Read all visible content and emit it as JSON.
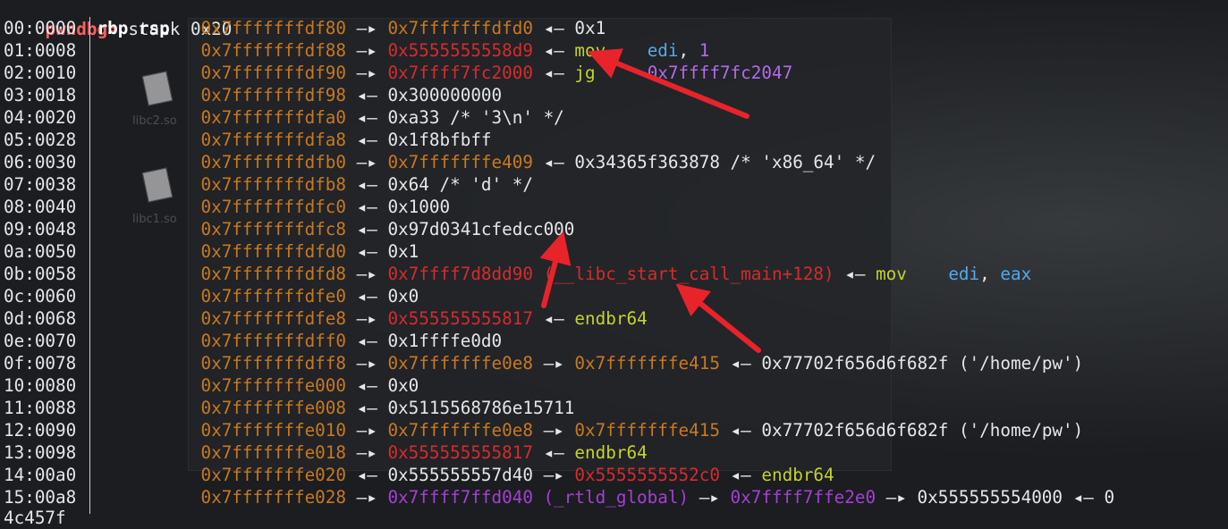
{
  "prompt": {
    "name": "pwndbg",
    "symbol": ">",
    "command": "stack 0x20"
  },
  "colors": {
    "stack_addr": "#c8791f",
    "code_addr": "#d72b2b",
    "heap_addr": "#a63fd3",
    "mnemonic": "#c5d22b",
    "register_operand": "#53a9e9",
    "prompt": "#ff5f5f",
    "annotation_arrow": "#e8232a"
  },
  "background": {
    "icons": [
      {
        "label": "libc2.so"
      },
      {
        "label": "libc1.so"
      }
    ]
  },
  "rows": [
    {
      "offset": "00:0000",
      "regs": "rbp rsp",
      "segs": [
        {
          "t": "0x7fffffffdf80",
          "c": "stack"
        },
        {
          "t": " —▸ ",
          "c": "arrowc"
        },
        {
          "t": "0x7fffffffdfd0",
          "c": "stack"
        },
        {
          "t": " ◂— ",
          "c": "arrowc"
        },
        {
          "t": "0x1",
          "c": "plain"
        }
      ]
    },
    {
      "offset": "01:0008",
      "regs": "",
      "segs": [
        {
          "t": "0x7fffffffdf88",
          "c": "stack"
        },
        {
          "t": " —▸ ",
          "c": "arrowc"
        },
        {
          "t": "0x5555555558d9",
          "c": "code"
        },
        {
          "t": " ◂— ",
          "c": "arrowc"
        },
        {
          "t": "mov    ",
          "c": "mnem"
        },
        {
          "t": "edi",
          "c": "op"
        },
        {
          "t": ", ",
          "c": "plain"
        },
        {
          "t": "1",
          "c": "opp"
        }
      ]
    },
    {
      "offset": "02:0010",
      "regs": "",
      "segs": [
        {
          "t": "0x7fffffffdf90",
          "c": "stack"
        },
        {
          "t": " —▸ ",
          "c": "arrowc"
        },
        {
          "t": "0x7ffff7fc2000",
          "c": "code"
        },
        {
          "t": " ◂— ",
          "c": "arrowc"
        },
        {
          "t": "jg     ",
          "c": "mnem"
        },
        {
          "t": "0x7ffff7fc2047",
          "c": "opp"
        }
      ]
    },
    {
      "offset": "03:0018",
      "regs": "",
      "segs": [
        {
          "t": "0x7fffffffdf98",
          "c": "stack"
        },
        {
          "t": " ◂— ",
          "c": "arrowc"
        },
        {
          "t": "0x300000000",
          "c": "plain"
        }
      ]
    },
    {
      "offset": "04:0020",
      "regs": "",
      "segs": [
        {
          "t": "0x7fffffffdfa0",
          "c": "stack"
        },
        {
          "t": " ◂— ",
          "c": "arrowc"
        },
        {
          "t": "0xa33 /* '3\\n' */",
          "c": "plain"
        }
      ]
    },
    {
      "offset": "05:0028",
      "regs": "",
      "segs": [
        {
          "t": "0x7fffffffdfa8",
          "c": "stack"
        },
        {
          "t": " ◂— ",
          "c": "arrowc"
        },
        {
          "t": "0x1f8bfbff",
          "c": "plain"
        }
      ]
    },
    {
      "offset": "06:0030",
      "regs": "",
      "segs": [
        {
          "t": "0x7fffffffdfb0",
          "c": "stack"
        },
        {
          "t": " —▸ ",
          "c": "arrowc"
        },
        {
          "t": "0x7fffffffe409",
          "c": "stack"
        },
        {
          "t": " ◂— ",
          "c": "arrowc"
        },
        {
          "t": "0x34365f363878 /* 'x86_64' */",
          "c": "plain"
        }
      ]
    },
    {
      "offset": "07:0038",
      "regs": "",
      "segs": [
        {
          "t": "0x7fffffffdfb8",
          "c": "stack"
        },
        {
          "t": " ◂— ",
          "c": "arrowc"
        },
        {
          "t": "0x64 /* 'd' */",
          "c": "plain"
        }
      ]
    },
    {
      "offset": "08:0040",
      "regs": "",
      "segs": [
        {
          "t": "0x7fffffffdfc0",
          "c": "stack"
        },
        {
          "t": " ◂— ",
          "c": "arrowc"
        },
        {
          "t": "0x1000",
          "c": "plain"
        }
      ]
    },
    {
      "offset": "09:0048",
      "regs": "",
      "segs": [
        {
          "t": "0x7fffffffdfc8",
          "c": "stack"
        },
        {
          "t": " ◂— ",
          "c": "arrowc"
        },
        {
          "t": "0x97d0341cfedcc000",
          "c": "plain"
        }
      ]
    },
    {
      "offset": "0a:0050",
      "regs": "",
      "segs": [
        {
          "t": "0x7fffffffdfd0",
          "c": "stack"
        },
        {
          "t": " ◂— ",
          "c": "arrowc"
        },
        {
          "t": "0x1",
          "c": "plain"
        }
      ]
    },
    {
      "offset": "0b:0058",
      "regs": "",
      "segs": [
        {
          "t": "0x7fffffffdfd8",
          "c": "stack"
        },
        {
          "t": " —▸ ",
          "c": "arrowc"
        },
        {
          "t": "0x7ffff7d8dd90 (__libc_start_call_main+128)",
          "c": "code"
        },
        {
          "t": " ◂— ",
          "c": "arrowc"
        },
        {
          "t": "mov    ",
          "c": "mnem"
        },
        {
          "t": "edi",
          "c": "op"
        },
        {
          "t": ", ",
          "c": "plain"
        },
        {
          "t": "eax",
          "c": "op"
        }
      ]
    },
    {
      "offset": "0c:0060",
      "regs": "",
      "segs": [
        {
          "t": "0x7fffffffdfe0",
          "c": "stack"
        },
        {
          "t": " ◂— ",
          "c": "arrowc"
        },
        {
          "t": "0x0",
          "c": "plain"
        }
      ]
    },
    {
      "offset": "0d:0068",
      "regs": "",
      "segs": [
        {
          "t": "0x7fffffffdfe8",
          "c": "stack"
        },
        {
          "t": " —▸ ",
          "c": "arrowc"
        },
        {
          "t": "0x555555555817",
          "c": "code"
        },
        {
          "t": " ◂— ",
          "c": "arrowc"
        },
        {
          "t": "endbr64",
          "c": "mnem"
        }
      ]
    },
    {
      "offset": "0e:0070",
      "regs": "",
      "segs": [
        {
          "t": "0x7fffffffdff0",
          "c": "stack"
        },
        {
          "t": " ◂— ",
          "c": "arrowc"
        },
        {
          "t": "0x1ffffe0d0",
          "c": "plain"
        }
      ]
    },
    {
      "offset": "0f:0078",
      "regs": "",
      "segs": [
        {
          "t": "0x7fffffffdff8",
          "c": "stack"
        },
        {
          "t": " —▸ ",
          "c": "arrowc"
        },
        {
          "t": "0x7fffffffe0e8",
          "c": "stack"
        },
        {
          "t": " —▸ ",
          "c": "arrowc"
        },
        {
          "t": "0x7fffffffe415",
          "c": "stack"
        },
        {
          "t": " ◂— ",
          "c": "arrowc"
        },
        {
          "t": "0x77702f656d6f682f ('/home/pw')",
          "c": "plain"
        }
      ]
    },
    {
      "offset": "10:0080",
      "regs": "",
      "segs": [
        {
          "t": "0x7fffffffe000",
          "c": "stack"
        },
        {
          "t": " ◂— ",
          "c": "arrowc"
        },
        {
          "t": "0x0",
          "c": "plain"
        }
      ]
    },
    {
      "offset": "11:0088",
      "regs": "",
      "segs": [
        {
          "t": "0x7fffffffe008",
          "c": "stack"
        },
        {
          "t": " ◂— ",
          "c": "arrowc"
        },
        {
          "t": "0x5115568786e15711",
          "c": "plain"
        }
      ]
    },
    {
      "offset": "12:0090",
      "regs": "",
      "segs": [
        {
          "t": "0x7fffffffe010",
          "c": "stack"
        },
        {
          "t": " —▸ ",
          "c": "arrowc"
        },
        {
          "t": "0x7fffffffe0e8",
          "c": "stack"
        },
        {
          "t": " —▸ ",
          "c": "arrowc"
        },
        {
          "t": "0x7fffffffe415",
          "c": "stack"
        },
        {
          "t": " ◂— ",
          "c": "arrowc"
        },
        {
          "t": "0x77702f656d6f682f ('/home/pw')",
          "c": "plain"
        }
      ]
    },
    {
      "offset": "13:0098",
      "regs": "",
      "segs": [
        {
          "t": "0x7fffffffe018",
          "c": "stack"
        },
        {
          "t": " —▸ ",
          "c": "arrowc"
        },
        {
          "t": "0x555555555817",
          "c": "code"
        },
        {
          "t": " ◂— ",
          "c": "arrowc"
        },
        {
          "t": "endbr64",
          "c": "mnem"
        }
      ]
    },
    {
      "offset": "14:00a0",
      "regs": "",
      "segs": [
        {
          "t": "0x7fffffffe020",
          "c": "stack"
        },
        {
          "t": " ◂— ",
          "c": "arrowc"
        },
        {
          "t": "0x555555557d40",
          "c": "plain"
        },
        {
          "t": " —▸ ",
          "c": "arrowc"
        },
        {
          "t": "0x5555555552c0",
          "c": "code"
        },
        {
          "t": " ◂— ",
          "c": "arrowc"
        },
        {
          "t": "endbr64",
          "c": "mnem"
        }
      ]
    },
    {
      "offset": "15:00a8",
      "regs": "",
      "segs": [
        {
          "t": "0x7fffffffe028",
          "c": "stack"
        },
        {
          "t": " —▸ ",
          "c": "arrowc"
        },
        {
          "t": "0x7ffff7ffd040 (_rtld_global)",
          "c": "heap"
        },
        {
          "t": " —▸ ",
          "c": "arrowc"
        },
        {
          "t": "0x7ffff7ffe2e0",
          "c": "heap"
        },
        {
          "t": " —▸ ",
          "c": "arrowc"
        },
        {
          "t": "0x555555554000",
          "c": "plain"
        },
        {
          "t": " ◂— ",
          "c": "arrowc"
        },
        {
          "t": "0",
          "c": "plain"
        }
      ]
    }
  ],
  "continuation": "4c457f"
}
